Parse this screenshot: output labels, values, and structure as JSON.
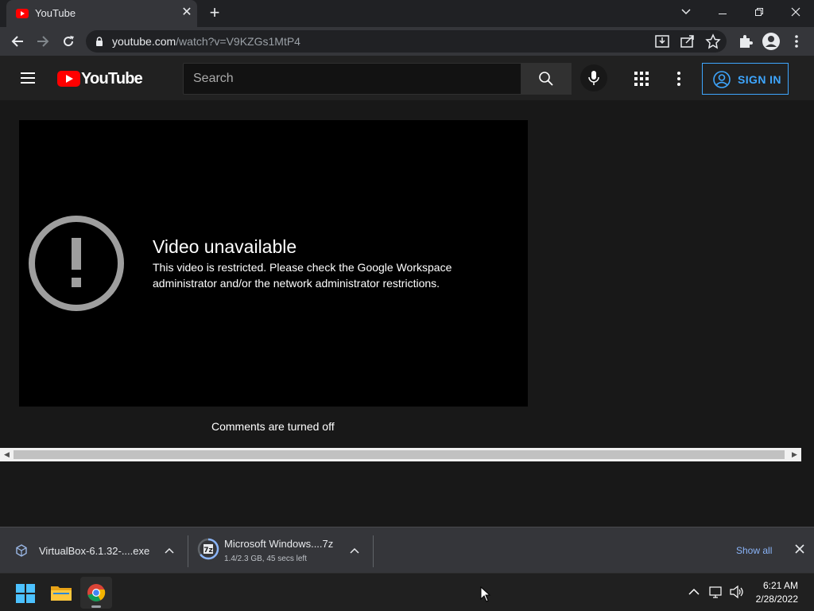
{
  "browser": {
    "tab_title": "YouTube",
    "url_host": "youtube.com",
    "url_rest": "/watch?v=V9KZGs1MtP4",
    "new_tab_label": "+"
  },
  "youtube": {
    "logo_text": "YouTube",
    "search_placeholder": "Search",
    "signin_label": "SIGN IN",
    "accent_color": "#3ea6ff",
    "brand_red": "#ff0000"
  },
  "player": {
    "error_title": "Video unavailable",
    "error_reason": "This video is restricted. Please check the Google Workspace administrator and/or the network administrator restrictions."
  },
  "comments": {
    "status": "Comments are turned off"
  },
  "downloads": {
    "items": [
      {
        "name": "VirtualBox-6.1.32-....exe",
        "status": ""
      },
      {
        "name": "Microsoft Windows....7z",
        "status": "1.4/2.3 GB, 45 secs left"
      }
    ],
    "show_all_label": "Show all"
  },
  "taskbar": {
    "time": "6:21 AM",
    "date": "2/28/2022"
  }
}
